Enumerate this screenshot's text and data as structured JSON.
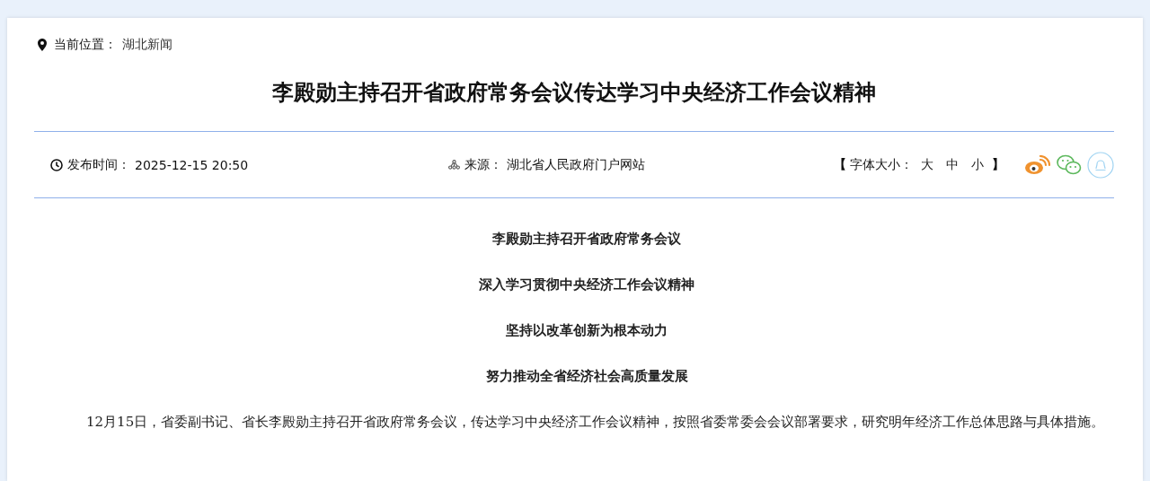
{
  "breadcrumb": {
    "label": "当前位置：",
    "link": "湖北新闻"
  },
  "title": "李殿勋主持召开省政府常务会议传达学习中央经济工作会议精神",
  "meta": {
    "published_label": "发布时间：",
    "published": "2025-12-15 20:50",
    "source_label": "来源：",
    "source": "湖北省人民政府门户网站",
    "font_size": {
      "open": "【",
      "label": "字体大小：",
      "sizes": [
        "大",
        "中",
        "小"
      ],
      "close": "】"
    }
  },
  "share": [
    {
      "kind": "weibo"
    },
    {
      "kind": "wechat"
    },
    {
      "kind": "qq"
    }
  ],
  "subheadings": [
    "李殿勋主持召开省政府常务会议",
    "深入学习贯彻中央经济工作会议精神",
    "坚持以改革创新为根本动力",
    "努力推动全省经济社会高质量发展"
  ],
  "paragraphs": [
    "12月15日，省委副书记、省长李殿勋主持召开省政府常务会议，传达学习中央经济工作会议精神，按照省委常委会会议部署要求，研究明年经济工作总体思路与具体措施。"
  ]
}
